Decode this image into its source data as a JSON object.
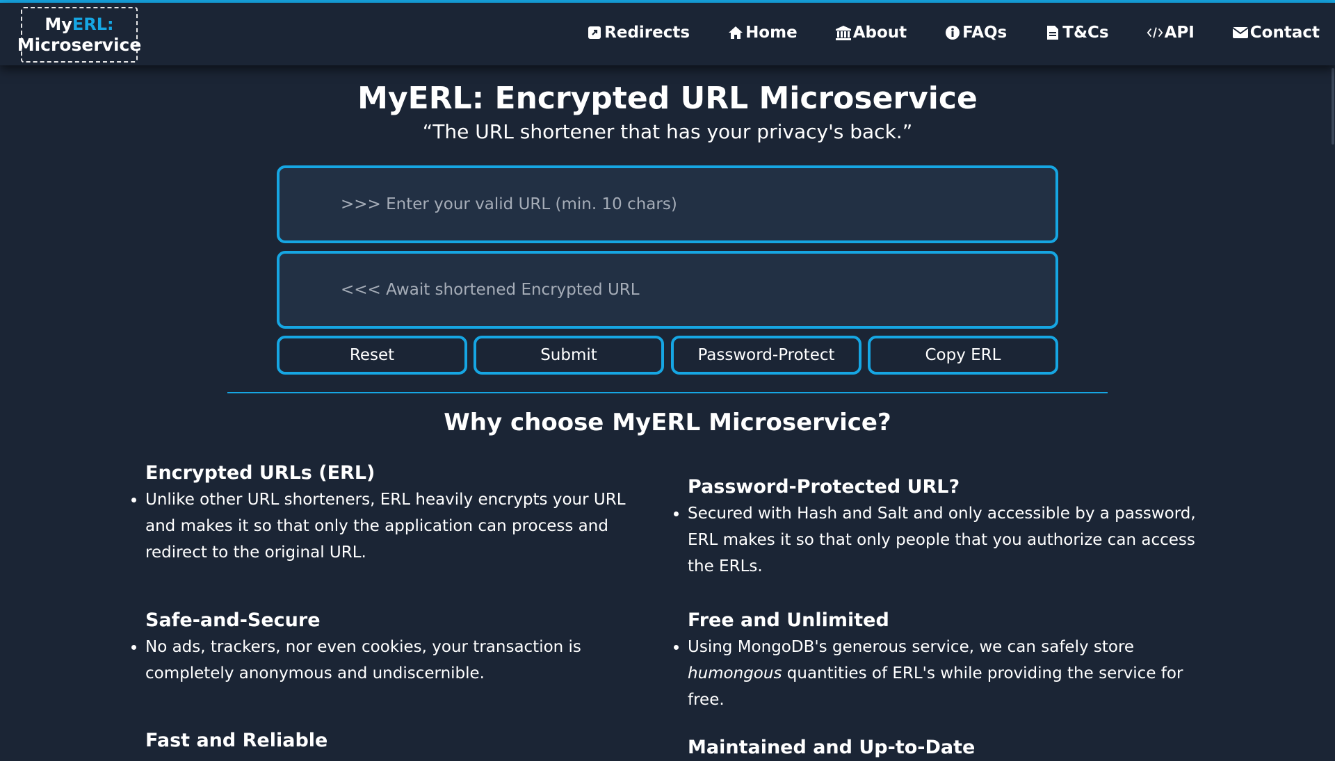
{
  "logo": {
    "line1_prefix": "My",
    "line1_highlight": "ERL:",
    "line2": "Microservice"
  },
  "nav": {
    "items": [
      {
        "label": "Redirects",
        "icon": "external-link-icon"
      },
      {
        "label": "Home",
        "icon": "home-icon"
      },
      {
        "label": "About",
        "icon": "bank-icon"
      },
      {
        "label": "FAQs",
        "icon": "info-icon"
      },
      {
        "label": "T&Cs",
        "icon": "document-icon"
      },
      {
        "label": "API",
        "icon": "code-icon"
      },
      {
        "label": "Contact",
        "icon": "envelope-icon"
      }
    ]
  },
  "main": {
    "title": "MyERL: Encrypted URL Microservice",
    "tagline": "“The URL shortener that has your privacy's back.”",
    "url_input": {
      "placeholder": ">>> Enter your valid URL (min. 10 chars)",
      "value": ""
    },
    "result_field": {
      "placeholder": "<<< Await shortened Encrypted URL",
      "value": ""
    },
    "buttons": {
      "reset": "Reset",
      "submit": "Submit",
      "password_protect": "Password-Protect",
      "copy": "Copy ERL"
    }
  },
  "why": {
    "heading": "Why choose MyERL Microservice?",
    "features": [
      {
        "title": "Encrypted URLs (ERL)",
        "text": "Unlike other URL shorteners, ERL heavily encrypts your URL and makes it so that only the application can process and redirect to the original URL."
      },
      {
        "title": "Password-Protected URL?",
        "text": "Secured with Hash and Salt and only accessible by a password, ERL makes it so that only people that you authorize can access the ERLs."
      },
      {
        "title": "Safe-and-Secure",
        "text": "No ads, trackers, nor even cookies, your transaction is completely anonymous and undiscernible."
      },
      {
        "title": "Free and Unlimited",
        "text_before": "Using MongoDB's generous service, we can safely store ",
        "text_em": "humongous",
        "text_after": " quantities of ERL's while providing the service for free."
      },
      {
        "title": "Fast and Reliable"
      },
      {
        "title": "Maintained and Up-to-Date"
      }
    ]
  },
  "colors": {
    "accent": "#16a6e3",
    "background": "#1b2535",
    "field_bg": "#223044",
    "placeholder": "#a6adb8"
  }
}
